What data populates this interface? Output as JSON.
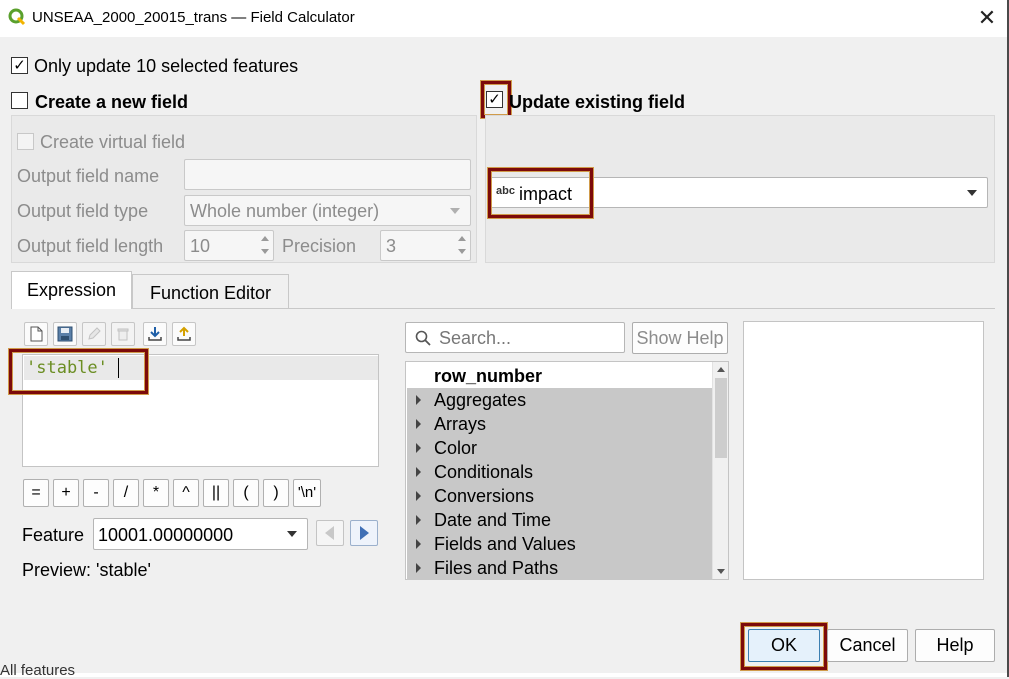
{
  "window": {
    "title": "UNSEAA_2000_20015_trans — Field Calculator",
    "close_glyph": "✕",
    "behind_text": "All features"
  },
  "options": {
    "only_update_selected": {
      "label": "Only update 10 selected features",
      "checked": true,
      "glyph": "✓"
    },
    "create_new_field": {
      "label": "Create a new field",
      "checked": false
    },
    "update_existing_field": {
      "label": "Update existing field",
      "checked": true,
      "glyph": "✓"
    }
  },
  "new_field": {
    "create_virtual_label": "Create virtual field",
    "output_name_label": "Output field name",
    "output_name_value": "",
    "output_type_label": "Output field type",
    "output_type_value": "Whole number (integer)",
    "output_length_label": "Output field length",
    "output_length_value": "10",
    "precision_label": "Precision",
    "precision_value": "3"
  },
  "existing_field": {
    "type_tag": "abc",
    "selected": "impact"
  },
  "tabs": [
    {
      "label": "Expression",
      "active": true
    },
    {
      "label": "Function Editor",
      "active": false
    }
  ],
  "toolbar_icons": [
    "new-file-icon",
    "save-icon",
    "edit-icon",
    "delete-icon",
    "import-icon",
    "export-icon"
  ],
  "expression": {
    "text": "'stable'"
  },
  "operators": [
    "=",
    "+",
    "-",
    "/",
    "*",
    "^",
    "||",
    "(",
    ")",
    "'\\n'"
  ],
  "feature": {
    "label": "Feature",
    "value": "10001.00000000"
  },
  "preview": {
    "text": "Preview: 'stable'"
  },
  "search": {
    "placeholder": "Search...",
    "show_help_label": "Show Help"
  },
  "functions": {
    "first": "row_number",
    "groups": [
      "Aggregates",
      "Arrays",
      "Color",
      "Conditionals",
      "Conversions",
      "Date and Time",
      "Fields and Values",
      "Files and Paths"
    ]
  },
  "buttons": {
    "ok": "OK",
    "cancel": "Cancel",
    "help": "Help"
  },
  "colors": {
    "highlight_border": "#7c0a0a",
    "expression_string": "#6b8e23",
    "group_row_bg": "#c8c8c8"
  }
}
